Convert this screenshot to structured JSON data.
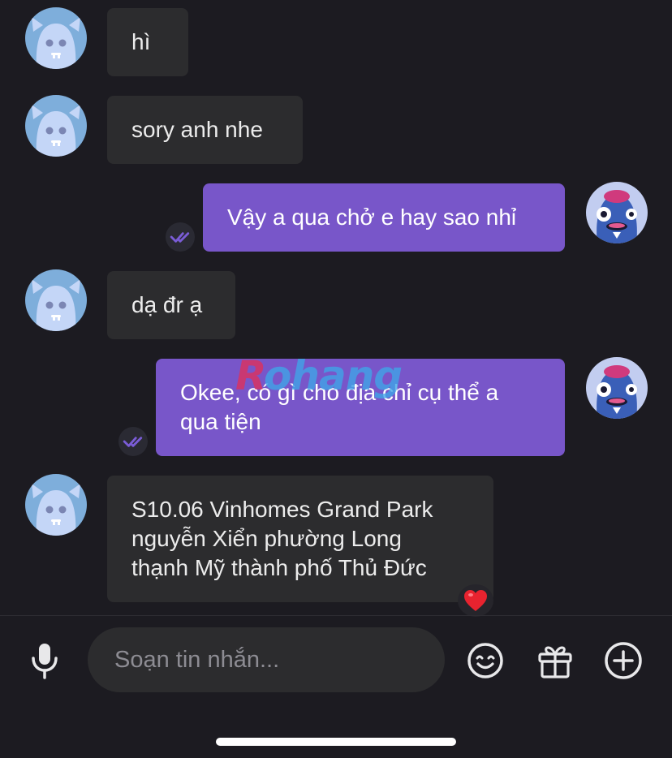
{
  "messages": [
    {
      "id": "m1",
      "side": "incoming",
      "lines": [
        "hì"
      ],
      "avatar": "ghost-avatar-icon"
    },
    {
      "id": "m2",
      "side": "incoming",
      "lines": [
        "sory anh nhe"
      ],
      "avatar": "ghost-avatar-icon"
    },
    {
      "id": "m3",
      "side": "outgoing",
      "lines": [
        "Vậy a qua chở e hay sao nhỉ"
      ],
      "avatar": "blue-monster-avatar-icon",
      "status": "seen"
    },
    {
      "id": "m4",
      "side": "incoming",
      "lines": [
        "dạ đr ạ"
      ],
      "avatar": "ghost-avatar-icon"
    },
    {
      "id": "m5",
      "side": "outgoing",
      "lines": [
        "Okee, có gì cho địa chỉ cụ thể a",
        "qua tiện"
      ],
      "avatar": "blue-monster-avatar-icon",
      "status": "seen"
    },
    {
      "id": "m6",
      "side": "incoming",
      "lines": [
        "S10.06 Vinhomes Grand Park",
        "nguyễn Xiển phường Long",
        "thạnh Mỹ thành phố Thủ Đức"
      ],
      "avatar": "ghost-avatar-icon",
      "reaction": "heart-reaction-icon"
    }
  ],
  "watermark": {
    "first": "R",
    "rest": "ohang"
  },
  "composer": {
    "placeholder": "Soạn tin nhắn...",
    "value": ""
  },
  "toolbar": {
    "mic": "microphone-icon",
    "emoji": "emoji-icon",
    "gift": "gift-icon",
    "add": "add-circle-icon"
  },
  "colors": {
    "background": "#1c1b21",
    "incoming_bubble": "#2c2c2e",
    "outgoing_bubble": "#7856c9",
    "seen_check": "#7a5cd6"
  }
}
